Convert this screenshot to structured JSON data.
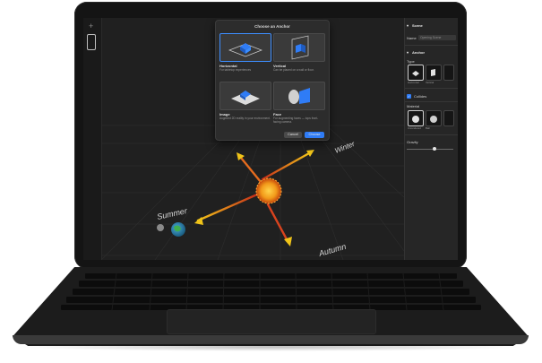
{
  "dialog": {
    "title": "Choose an Anchor",
    "options": [
      {
        "title": "Horizontal",
        "desc": "For tabletop experiences",
        "icon": "horizontal-plane-icon"
      },
      {
        "title": "Vertical",
        "desc": "Can be placed on a wall or floor.",
        "icon": "vertical-plane-icon"
      },
      {
        "title": "Image",
        "desc": "Augment 2D reality in your environment.",
        "icon": "image-anchor-icon"
      },
      {
        "title": "Face",
        "desc": "For augmenting faces — tops front-facing camera.",
        "icon": "face-anchor-icon"
      }
    ],
    "cancel_label": "Cancel",
    "choose_label": "Choose",
    "selected_index": 0
  },
  "scene": {
    "labels": {
      "winter": "Winter",
      "summer": "Summer",
      "autumn": "Autumn"
    }
  },
  "panel": {
    "scene_header": "Scene",
    "name_label": "Name",
    "name_value": "Opening Scene",
    "anchor_header": "Anchor",
    "type_label": "Type",
    "type_options": [
      "Horizontal",
      "Vertical"
    ],
    "collides_label": "Collides",
    "collides_checked": true,
    "material_label": "Material",
    "material_options": [
      "Unrendered",
      "Ball"
    ],
    "gravity_label": "Gravity",
    "gravity_level": 0.6
  },
  "colors": {
    "accent": "#2f7cf6",
    "sun": "#f29a1a",
    "arrow": "#f0c419"
  }
}
